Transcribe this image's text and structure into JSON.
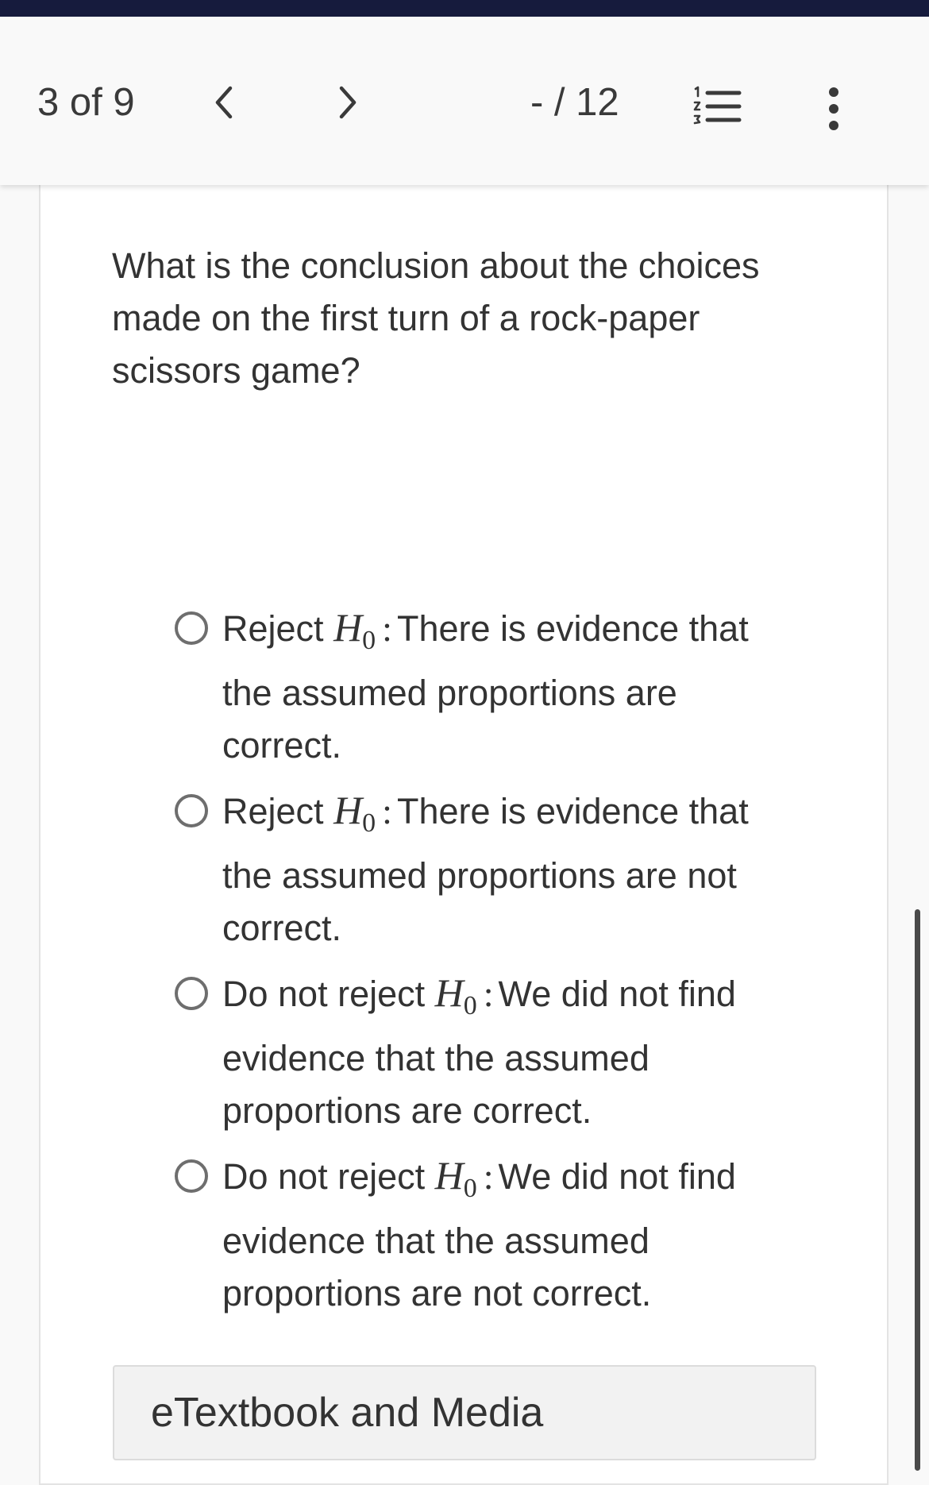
{
  "header": {
    "question_counter": "3 of 9",
    "score": "- / 12",
    "prev_icon": "chevron-left-icon",
    "next_icon": "chevron-right-icon",
    "list_icon": "numbered-list-icon",
    "more_icon": "vertical-ellipsis-icon"
  },
  "question": {
    "text": "What is the conclusion about the choices made on the first turn of a rock-paper scissors game?"
  },
  "options": [
    {
      "prefix": "Reject ",
      "symbol": "H",
      "subscript": "0",
      "colon": ":",
      "text": "There is evidence that the assumed proportions are correct."
    },
    {
      "prefix": "Reject ",
      "symbol": "H",
      "subscript": "0",
      "colon": ":",
      "text": "There is evidence that the assumed proportions are not correct."
    },
    {
      "prefix": "Do not reject ",
      "symbol": "H",
      "subscript": "0",
      "colon": ":",
      "text": "We did not find evidence that the assumed proportions are correct."
    },
    {
      "prefix": "Do not reject ",
      "symbol": "H",
      "subscript": "0",
      "colon": ":",
      "text": "We did not find evidence that the assumed proportions are not correct."
    }
  ],
  "resources": {
    "label": "eTextbook and Media"
  },
  "colors": {
    "top_strip": "#161b3d",
    "text": "#333333",
    "radio_border": "#6e6e6e",
    "resource_bg": "#f2f2f2"
  }
}
